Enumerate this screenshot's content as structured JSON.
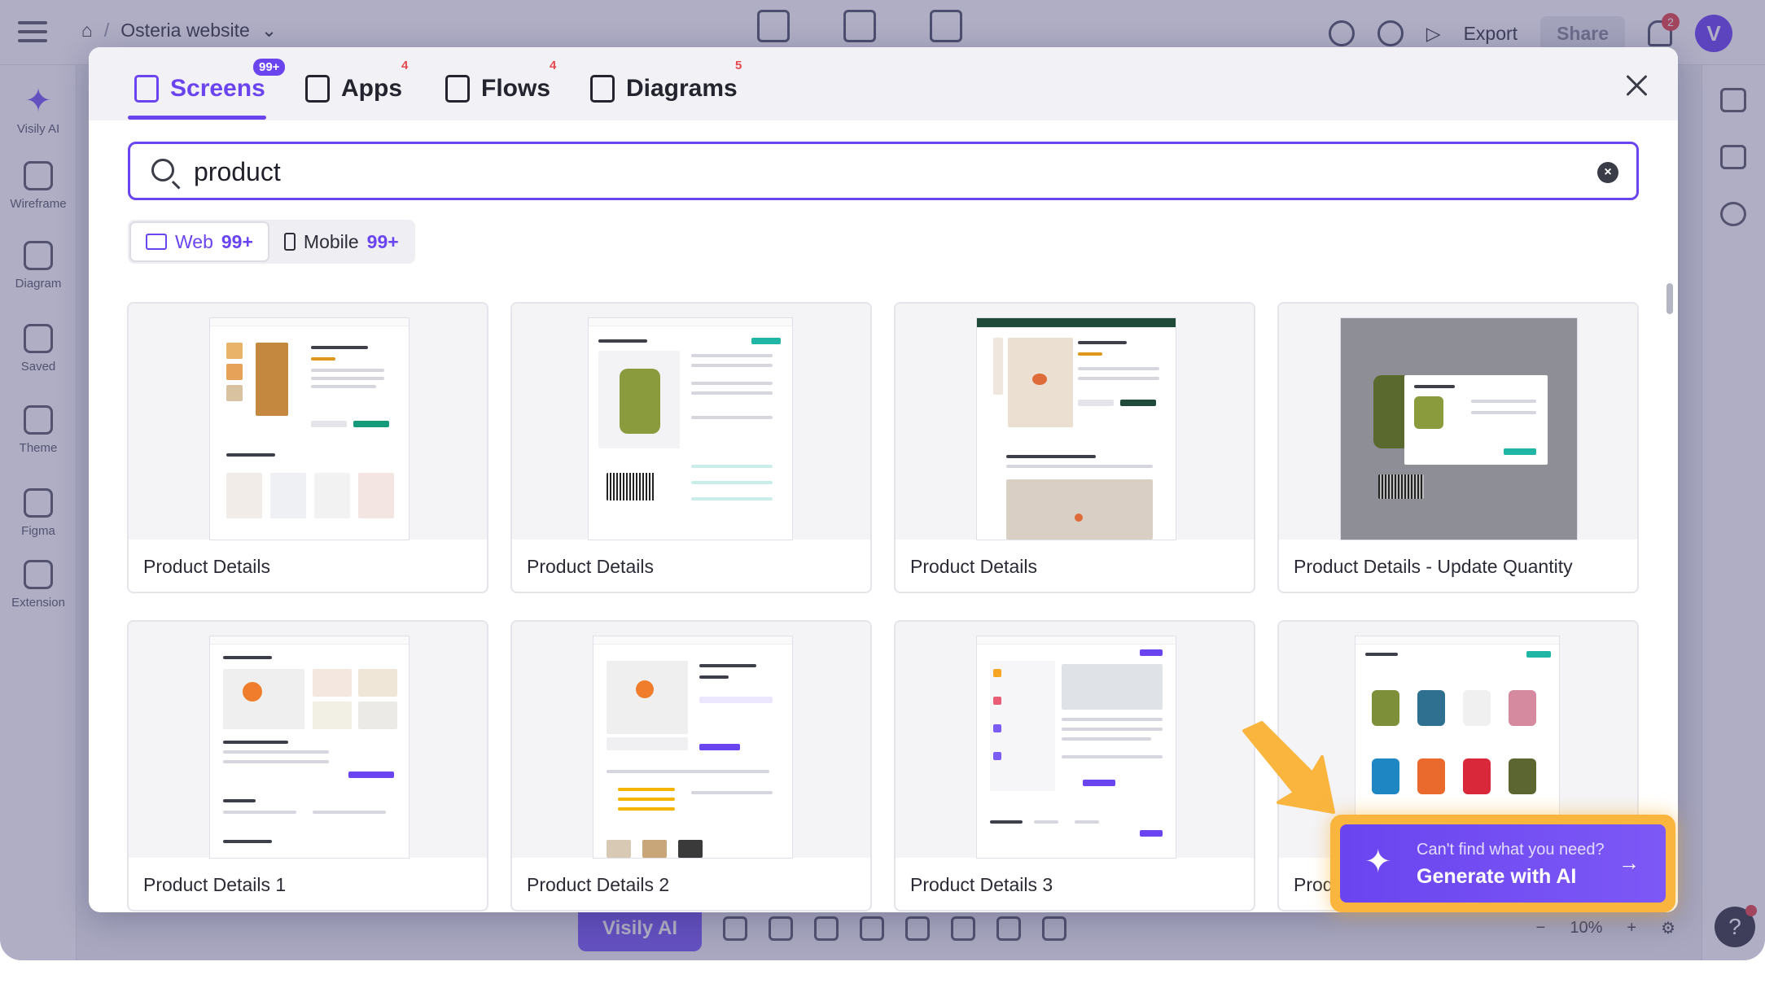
{
  "topbar": {
    "breadcrumb_project": "Osteria website",
    "export_label": "Export",
    "share_label": "Share",
    "notifications_count": "2",
    "avatar_letter": "V"
  },
  "leftbar": {
    "items": [
      {
        "label": "Visily AI",
        "icon": "sparkle-icon"
      },
      {
        "label": "Wireframe",
        "icon": "wireframe-icon"
      },
      {
        "label": "Diagram",
        "icon": "diagram-icon"
      },
      {
        "label": "Saved",
        "icon": "saved-icon"
      },
      {
        "label": "Theme",
        "icon": "theme-icon"
      },
      {
        "label": "Figma",
        "icon": "figma-icon"
      },
      {
        "label": "Extension",
        "icon": "extension-icon"
      }
    ]
  },
  "bottombar": {
    "visily_ai_label": "Visily AI",
    "zoom_level": "10%"
  },
  "modal": {
    "tabs": [
      {
        "label": "Screens",
        "badge": "99+",
        "active": true,
        "icon": "screen-icon"
      },
      {
        "label": "Apps",
        "badge": "4",
        "active": false,
        "icon": "apps-icon"
      },
      {
        "label": "Flows",
        "badge": "4",
        "active": false,
        "icon": "flows-icon"
      },
      {
        "label": "Diagrams",
        "badge": "5",
        "active": false,
        "icon": "diagrams-icon"
      }
    ],
    "search": {
      "value": "product",
      "placeholder": ""
    },
    "platforms": [
      {
        "label": "Web",
        "count": "99+",
        "active": true
      },
      {
        "label": "Mobile",
        "count": "99+",
        "active": false
      }
    ],
    "cards": [
      {
        "label": "Product Details"
      },
      {
        "label": "Product Details"
      },
      {
        "label": "Product Details"
      },
      {
        "label": "Product Details - Update Quantity"
      },
      {
        "label": "Product Details 1"
      },
      {
        "label": "Product Details 2"
      },
      {
        "label": "Product Details 3"
      },
      {
        "label": "Prod"
      }
    ]
  },
  "cta": {
    "line1": "Can't find what you need?",
    "line2": "Generate with AI"
  },
  "colors": {
    "accent": "#6a44ef",
    "highlight": "#f9b53e",
    "badge_red": "#e5484d"
  }
}
